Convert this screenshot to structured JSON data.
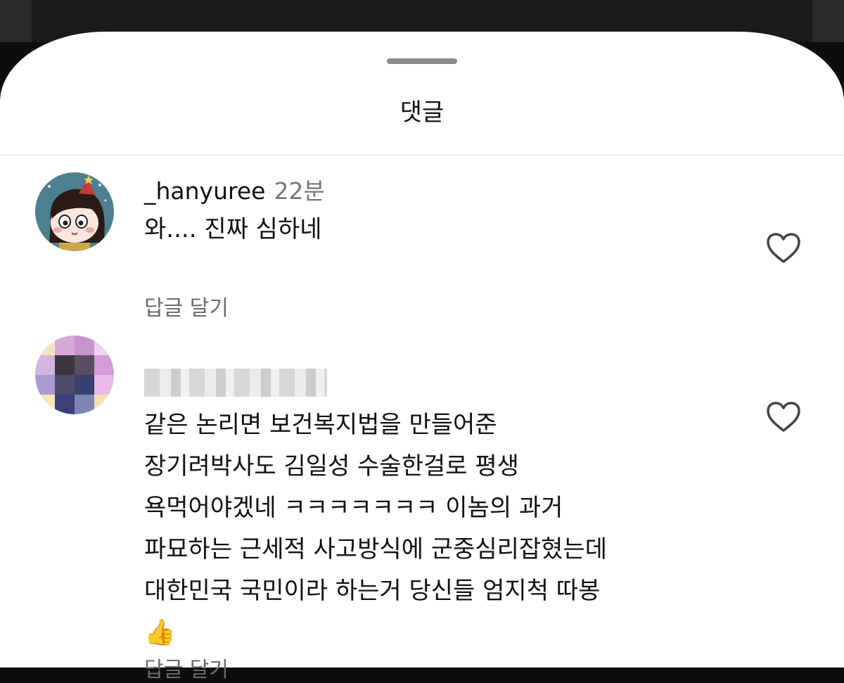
{
  "sheet": {
    "title": "댓글"
  },
  "comments": [
    {
      "username": "_hanyuree",
      "time": "22분",
      "text": "와.... 진짜 심하네",
      "reply_label": "답글 달기"
    },
    {
      "username_obscured": true,
      "lines": [
        "같은 논리면 보건복지법을 만들어준",
        "장기려박사도 김일성 수술한걸로 평생",
        "욕먹어야겠네 ㅋㅋㅋㅋㅋㅋㅋ 이놈의 과거",
        "파묘하는 근세적 사고방식에 군중심리잡혔는데",
        "대한민국 국민이라 하는거 당신들 엄지척 따봉"
      ],
      "emoji": "👍",
      "reply_label": "답글 달기"
    }
  ],
  "icons": {
    "like": "heart-outline-icon",
    "avatar_1": "cartoon-girl-avatar",
    "avatar_2": "blurred-avatar"
  },
  "colors": {
    "text": "#111111",
    "muted": "#6b6b6b",
    "sheet": "#ffffff"
  }
}
